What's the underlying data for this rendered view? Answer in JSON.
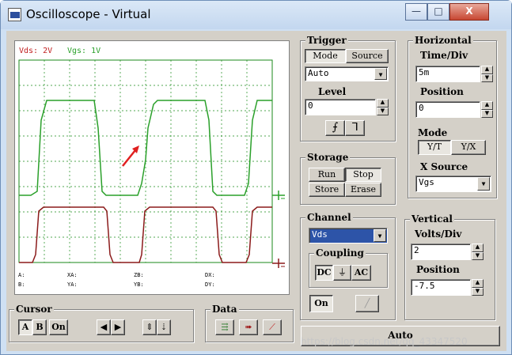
{
  "window": {
    "title": "Oscilloscope - Virtual",
    "minimize": "—",
    "maximize": "□",
    "close": "X"
  },
  "screen": {
    "ch1_label": "Vds: 2V",
    "ch2_label": "Vgs: 1V",
    "colors": {
      "vds": "#8b1a1a",
      "vgs": "#2aa02a",
      "grid": "#1a8a1a"
    },
    "measurements": [
      {
        "k": "A:",
        "v": ""
      },
      {
        "k": "XA:",
        "v": ""
      },
      {
        "k": "ZB:",
        "v": ""
      },
      {
        "k": "DX:",
        "v": ""
      },
      {
        "k": "B:",
        "v": ""
      },
      {
        "k": "YA:",
        "v": ""
      },
      {
        "k": "YB:",
        "v": ""
      },
      {
        "k": "DY:",
        "v": ""
      }
    ]
  },
  "trigger": {
    "title": "Trigger",
    "mode_btn": "Mode",
    "source_btn": "Source",
    "mode_value": "Auto",
    "level_label": "Level",
    "level_value": "0",
    "falling_icon": "falling-edge-icon",
    "rising_icon": "rising-edge-icon"
  },
  "horizontal": {
    "title": "Horizontal",
    "timediv_label": "Time/Div",
    "timediv_value": "5m",
    "position_label": "Position",
    "position_value": "0",
    "mode_label": "Mode",
    "yt_btn": "Y/T",
    "yx_btn": "Y/X",
    "xsource_label": "X Source",
    "xsource_value": "Vgs"
  },
  "storage": {
    "title": "Storage",
    "run": "Run",
    "stop": "Stop",
    "store": "Store",
    "erase": "Erase"
  },
  "channel": {
    "title": "Channel",
    "selected": "Vds",
    "coupling_label": "Coupling",
    "dc": "DC",
    "ac": "AC",
    "on": "On"
  },
  "vertical": {
    "title": "Vertical",
    "voltsdiv_label": "Volts/Div",
    "voltsdiv_value": "2",
    "position_label": "Position",
    "position_value": "-7.5"
  },
  "cursor": {
    "title": "Cursor",
    "a": "A",
    "b": "B",
    "on": "On"
  },
  "data_group": {
    "title": "Data"
  },
  "auto_btn": "Auto",
  "watermark": "https://blog.csdn.net/qq_43347520"
}
